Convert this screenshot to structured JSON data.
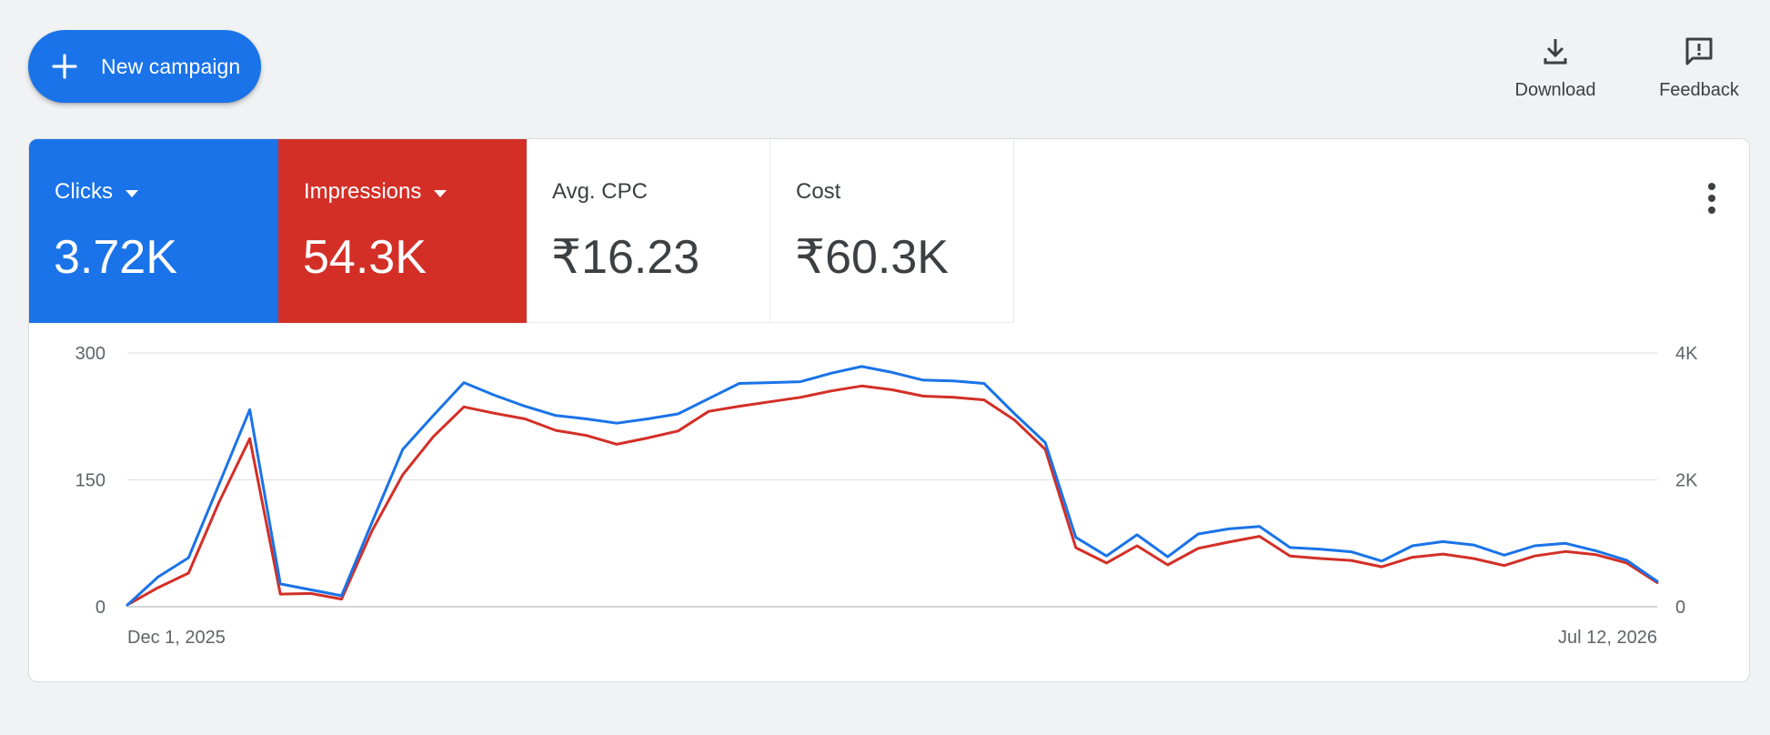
{
  "toolbar": {
    "new_campaign_label": "New campaign",
    "download_label": "Download",
    "feedback_label": "Feedback"
  },
  "metrics": [
    {
      "name": "Clicks",
      "value": "3.72K",
      "color": "#1a73e8",
      "has_dropdown": true
    },
    {
      "name": "Impressions",
      "value": "54.3K",
      "color": "#d32f27",
      "has_dropdown": true
    },
    {
      "name": "Avg. CPC",
      "value": "₹16.23"
    },
    {
      "name": "Cost",
      "value": "₹60.3K"
    }
  ],
  "icons": {
    "new_campaign": "plus-icon",
    "download": "download-icon",
    "feedback": "feedback-icon",
    "more": "more-vert-icon"
  },
  "chart_data": {
    "type": "line",
    "grid": true,
    "x_labels": [
      "Dec 1, 2025",
      "Jul 12, 2026"
    ],
    "y_left": {
      "ticks": [
        "0",
        "150",
        "300"
      ],
      "range": [
        0,
        300
      ]
    },
    "y_right": {
      "ticks": [
        "0",
        "2K",
        "4K"
      ],
      "range": [
        0,
        4000
      ]
    },
    "series": [
      {
        "name": "Clicks",
        "axis": "left",
        "color": "#1a73e8",
        "values": [
          2,
          35,
          58,
          145,
          233,
          27,
          20,
          13,
          100,
          186,
          226,
          265,
          250,
          237,
          226,
          222,
          217,
          222,
          228,
          246,
          264,
          265,
          266,
          276,
          284,
          277,
          268,
          267,
          264,
          228,
          194,
          82,
          60,
          85,
          59,
          86,
          92,
          95,
          70,
          68,
          65,
          54,
          72,
          77,
          73,
          61,
          72,
          75,
          66,
          55,
          30
        ]
      },
      {
        "name": "Impressions",
        "axis": "right",
        "color": "#d32f27",
        "values": [
          30,
          300,
          530,
          1650,
          2650,
          200,
          210,
          120,
          1200,
          2080,
          2680,
          3150,
          3050,
          2960,
          2780,
          2700,
          2560,
          2660,
          2770,
          3080,
          3160,
          3230,
          3300,
          3400,
          3480,
          3420,
          3320,
          3300,
          3260,
          2940,
          2480,
          930,
          690,
          960,
          660,
          920,
          1020,
          1110,
          800,
          760,
          730,
          630,
          780,
          830,
          760,
          650,
          800,
          870,
          820,
          690,
          380
        ]
      }
    ]
  }
}
